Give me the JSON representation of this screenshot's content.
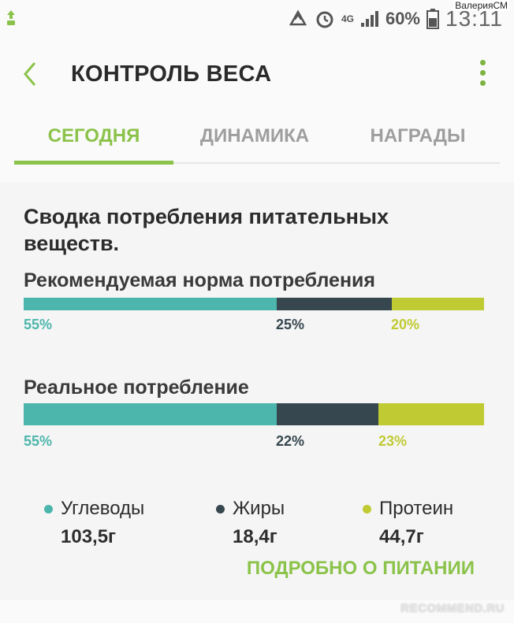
{
  "status_bar": {
    "network": "4G",
    "battery": "60%",
    "time": "13:11",
    "watermark": "ВалерияСМ"
  },
  "app_bar": {
    "title": "КОНТРОЛЬ ВЕСА",
    "back_icon": "chevron-left-icon",
    "menu_icon": "more-vert-icon"
  },
  "tabs": [
    {
      "label": "СЕГОДНЯ",
      "active": true
    },
    {
      "label": "ДИНАМИКА",
      "active": false
    },
    {
      "label": "НАГРАДЫ",
      "active": false
    }
  ],
  "card": {
    "title": "Сводка потребления питательных веществ.",
    "recommended": {
      "label": "Рекомендуемая норма потребления",
      "carbs_pct": "55%",
      "fat_pct": "25%",
      "protein_pct": "20%",
      "carbs_value": 55,
      "fat_value": 25,
      "protein_value": 20
    },
    "actual": {
      "label": "Реальное потребление",
      "carbs_pct": "55%",
      "fat_pct": "22%",
      "protein_pct": "23%",
      "carbs_value": 55,
      "fat_value": 22,
      "protein_value": 23
    },
    "legend": [
      {
        "name": "Углеводы",
        "value": "103,5г",
        "color": "#4db6ac"
      },
      {
        "name": "Жиры",
        "value": "18,4г",
        "color": "#37474f"
      },
      {
        "name": "Протеин",
        "value": "44,7г",
        "color": "#c0ca33"
      }
    ],
    "details_link": "ПОДРОБНО О ПИТАНИИ"
  },
  "colors": {
    "accent": "#8bc34a",
    "carbs": "#4db6ac",
    "fat": "#37474f",
    "protein": "#c0ca33"
  },
  "watermark": "RECOMMEND.RU"
}
